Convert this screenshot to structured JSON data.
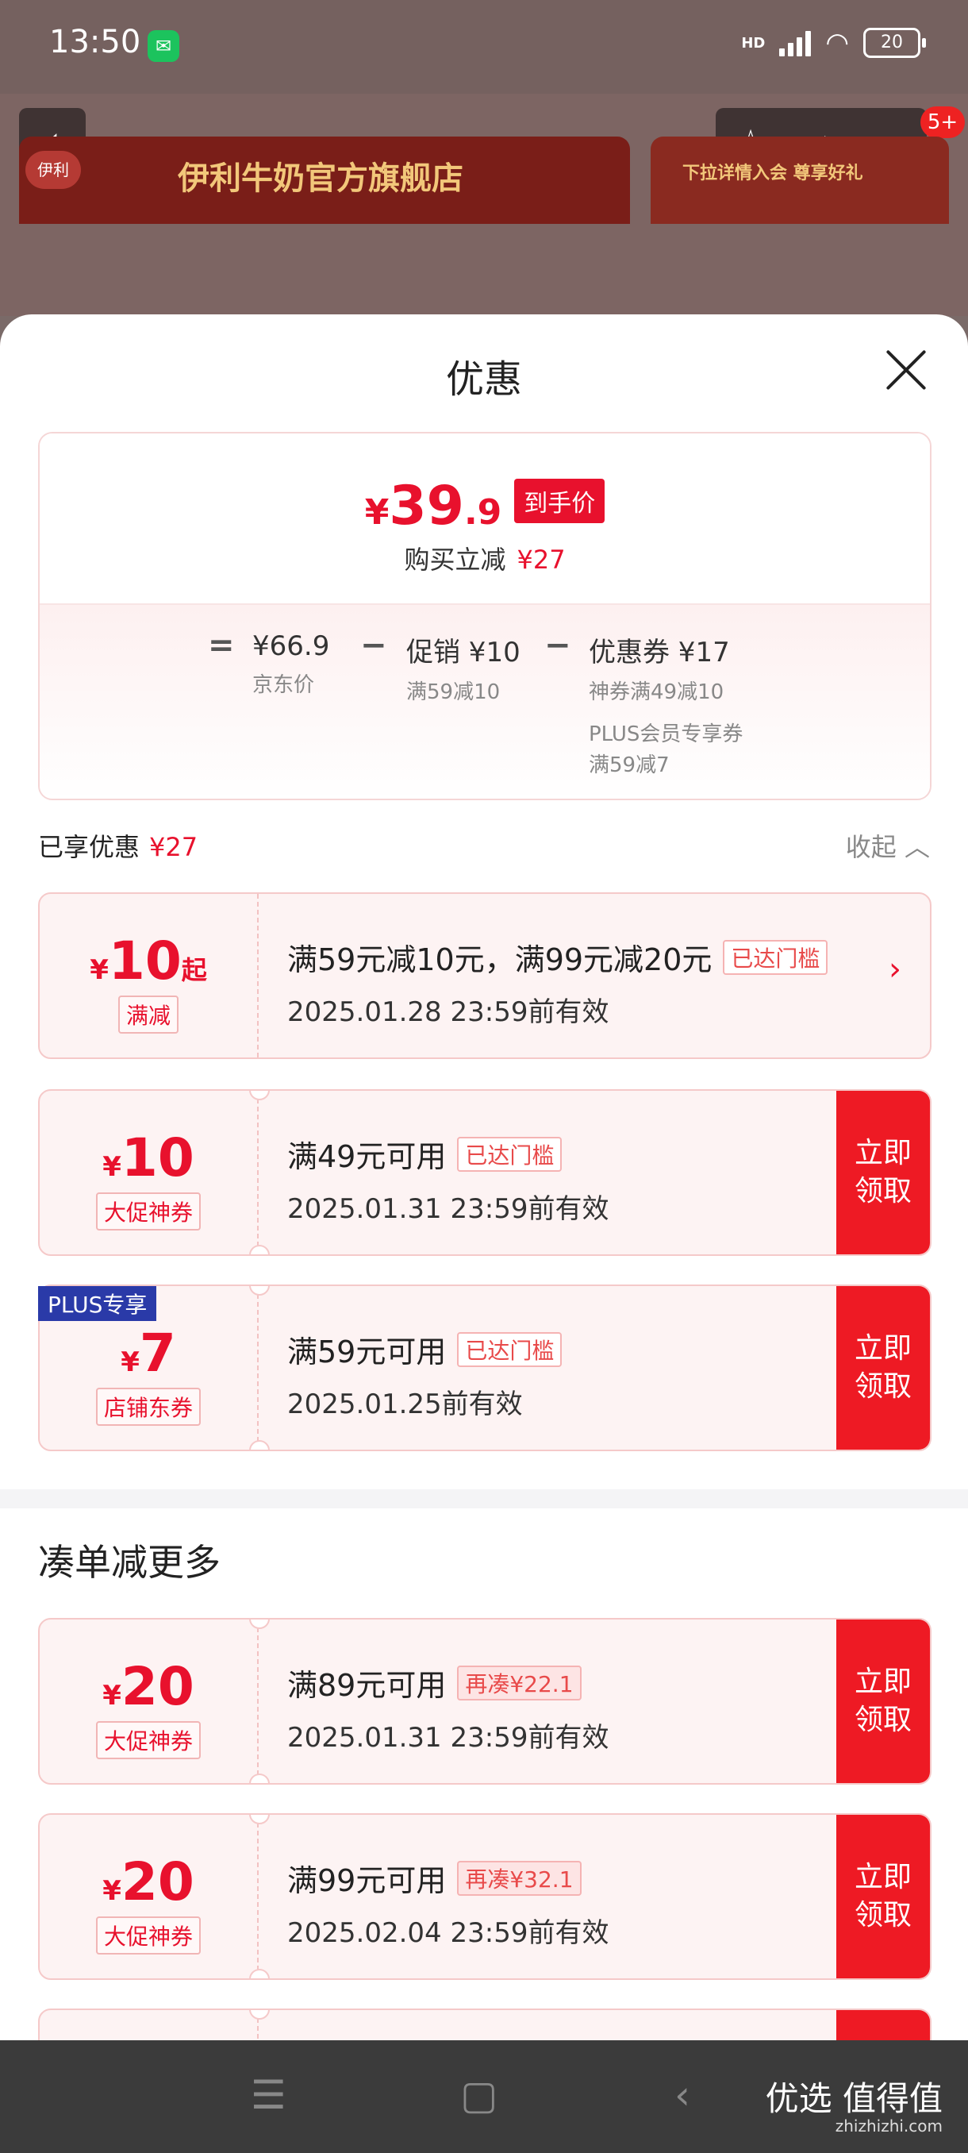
{
  "status_bar": {
    "time": "13:50",
    "network": "HD",
    "battery": "20"
  },
  "header": {
    "badge": "5+"
  },
  "banners": {
    "store_name": "伊利牛奶官方旗舰店",
    "promo": "下拉详情入会 尊享好礼"
  },
  "sheet": {
    "title": "优惠",
    "summary": {
      "currency": "¥",
      "price_int": "39",
      "price_dec": ".9",
      "final_tag": "到手价",
      "reduce_label": "购买立减",
      "reduce_amount": "¥27",
      "equals": "=",
      "minus": "−",
      "jd_price": "¥66.9",
      "jd_price_label": "京东价",
      "promo": "促销 ¥10",
      "promo_rule": "满59减10",
      "coupon": "优惠券 ¥17",
      "coupon_rule1": "神券满49减10",
      "coupon_rule2": "PLUS会员专享券",
      "coupon_rule3": "满59减7"
    },
    "enjoyed": {
      "label": "已享优惠",
      "amount": "¥27",
      "collapse": "收起"
    },
    "coupons": [
      {
        "currency": "¥",
        "amount": "10",
        "suffix": "起",
        "type": "满减",
        "condition": "满59元减10元，满99元减20元",
        "tag": "已达门槛",
        "validity": "2025.01.28 23:59前有效"
      },
      {
        "currency": "¥",
        "amount": "10",
        "type": "大促神券",
        "condition": "满49元可用",
        "tag": "已达门槛",
        "validity": "2025.01.31 23:59前有效",
        "claim": "立即领取"
      },
      {
        "plus": "PLUS专享",
        "currency": "¥",
        "amount": "7",
        "type": "店铺东券",
        "condition": "满59元可用",
        "tag": "已达门槛",
        "validity": "2025.01.25前有效",
        "claim": "立即领取"
      }
    ],
    "more_section": {
      "title": "凑单减更多",
      "coupons": [
        {
          "currency": "¥",
          "amount": "20",
          "type": "大促神券",
          "condition": "满89元可用",
          "tag": "再凑¥22.1",
          "validity": "2025.01.31 23:59前有效",
          "claim": "立即领取"
        },
        {
          "currency": "¥",
          "amount": "20",
          "type": "大促神券",
          "condition": "满99元可用",
          "tag": "再凑¥32.1",
          "validity": "2025.02.04 23:59前有效",
          "claim": "立即领取"
        }
      ]
    }
  },
  "watermark": {
    "text": "优选 值得值",
    "sub": "zhizhizhi.com"
  }
}
